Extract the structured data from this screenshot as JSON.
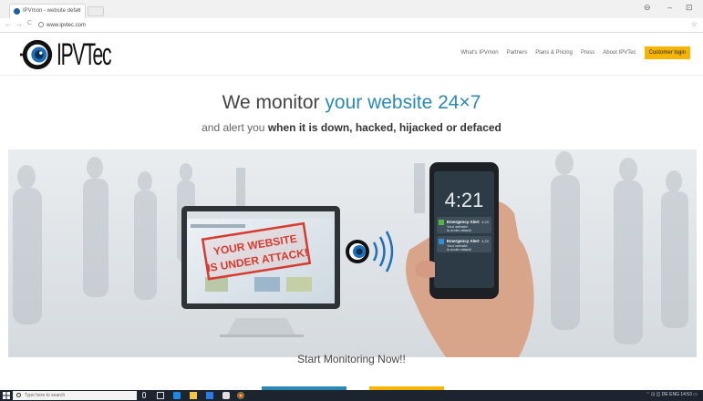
{
  "browser": {
    "tab_title": "IPVmon - website defac",
    "tab_close": "×",
    "url": "www.ipvtec.com",
    "back": "←",
    "forward": "→",
    "reload": "C",
    "bookmark": "☆",
    "win_user": "⊖",
    "win_min": "–",
    "win_restore": "⊡"
  },
  "site": {
    "logo_text": "IPVTec",
    "nav": [
      "What's IPVmon",
      "Partners",
      "Plans & Pricing",
      "Press",
      "About IPVTec"
    ],
    "login_label": "Customer login",
    "accent": "#2b8ab3",
    "login_color": "#f7b500"
  },
  "hero": {
    "headline_pre": "We monitor ",
    "headline_hl": "your website 24×7",
    "subline_pre": "and alert you ",
    "subline_bold": "when it is down, hacked, hijacked or defaced",
    "stamp_line1": "YOUR WEBSITE",
    "stamp_line2": "IS UNDER ATTACK!",
    "phone_time": "4:21",
    "alert_title": "Emergency Alert",
    "alert_line1": "Your website",
    "alert_line2": "is under attack!",
    "alert_time": "4:20",
    "cta": "Start Monitoring Now!!"
  },
  "taskbar": {
    "search_placeholder": "Type here to search",
    "lang": "DE",
    "lang2": "ENG",
    "time": "14:53"
  }
}
